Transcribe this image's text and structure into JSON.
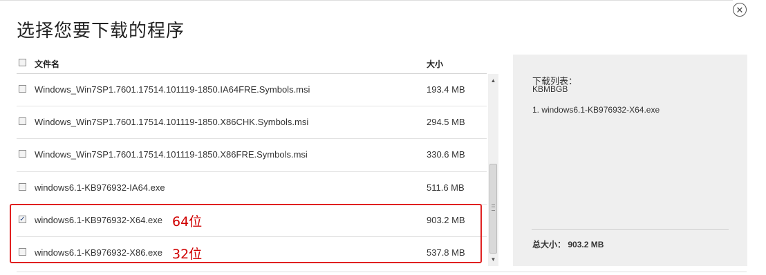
{
  "dialog": {
    "title": "选择您要下载的程序",
    "close_symbol": "✕"
  },
  "list": {
    "header": {
      "name_label": "文件名",
      "size_label": "大小",
      "select_all_checked": false
    },
    "rows": [
      {
        "name": "Windows_Win7SP1.7601.17514.101119-1850.IA64FRE.Symbols.msi",
        "size": "193.4 MB",
        "checked": false,
        "annotation": ""
      },
      {
        "name": "Windows_Win7SP1.7601.17514.101119-1850.X86CHK.Symbols.msi",
        "size": "294.5 MB",
        "checked": false,
        "annotation": ""
      },
      {
        "name": "Windows_Win7SP1.7601.17514.101119-1850.X86FRE.Symbols.msi",
        "size": "330.6 MB",
        "checked": false,
        "annotation": ""
      },
      {
        "name": "windows6.1-KB976932-IA64.exe",
        "size": "511.6 MB",
        "checked": false,
        "annotation": ""
      },
      {
        "name": "windows6.1-KB976932-X64.exe",
        "size": "903.2 MB",
        "checked": true,
        "annotation": "64位"
      },
      {
        "name": "windows6.1-KB976932-X86.exe",
        "size": "537.8 MB",
        "checked": false,
        "annotation": "32位"
      }
    ]
  },
  "scrollbar": {
    "up_symbol": "▲",
    "down_symbol": "▼"
  },
  "panel": {
    "download_list_label": "下载列表：",
    "download_list_name": "KBMBGB",
    "selected_item": "1. windows6.1-KB976932-X64.exe",
    "total_label": "总大小：",
    "total_value": "903.2 MB"
  },
  "colors": {
    "annotation_red": "#d00000",
    "highlight_border": "#e02020",
    "panel_bg": "#efefef"
  }
}
